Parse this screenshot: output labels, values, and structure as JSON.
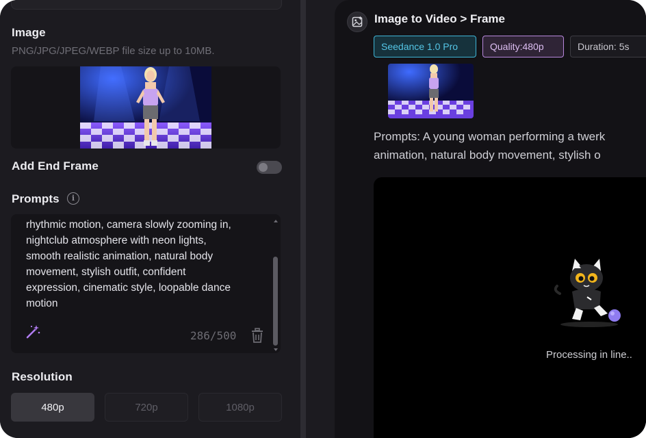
{
  "left_panel": {
    "image_section": {
      "title": "Image",
      "hint": "PNG/JPG/JPEG/WEBP file size up to 10MB."
    },
    "end_frame": {
      "label": "Add End Frame",
      "enabled": false
    },
    "prompts": {
      "title": "Prompts",
      "text": "rhythmic motion, camera slowly zooming in,\nnightclub atmosphere with neon lights,\nsmooth realistic animation, natural body\nmovement, stylish outfit, confident\nexpression, cinematic style, loopable dance\nmotion",
      "counter": "286/500"
    },
    "resolution": {
      "title": "Resolution",
      "options": [
        "480p",
        "720p",
        "1080p"
      ],
      "selected": "480p"
    }
  },
  "right_panel": {
    "task_title": "Image to Video > Frame",
    "tags": {
      "model": "Seedance 1.0 Pro",
      "quality": "Quality:480p",
      "duration": "Duration: 5s"
    },
    "prompt_summary_line1": "Prompts: A young woman performing a twerk",
    "prompt_summary_line2": "animation, natural body movement, stylish o",
    "status": "Processing in line.."
  },
  "colors": {
    "panel_bg": "#1c1b20",
    "right_bg": "#131216",
    "model_tag": "#3fb6d8",
    "quality_tag": "#b888dd",
    "accent_purple": "#b07cf0"
  }
}
